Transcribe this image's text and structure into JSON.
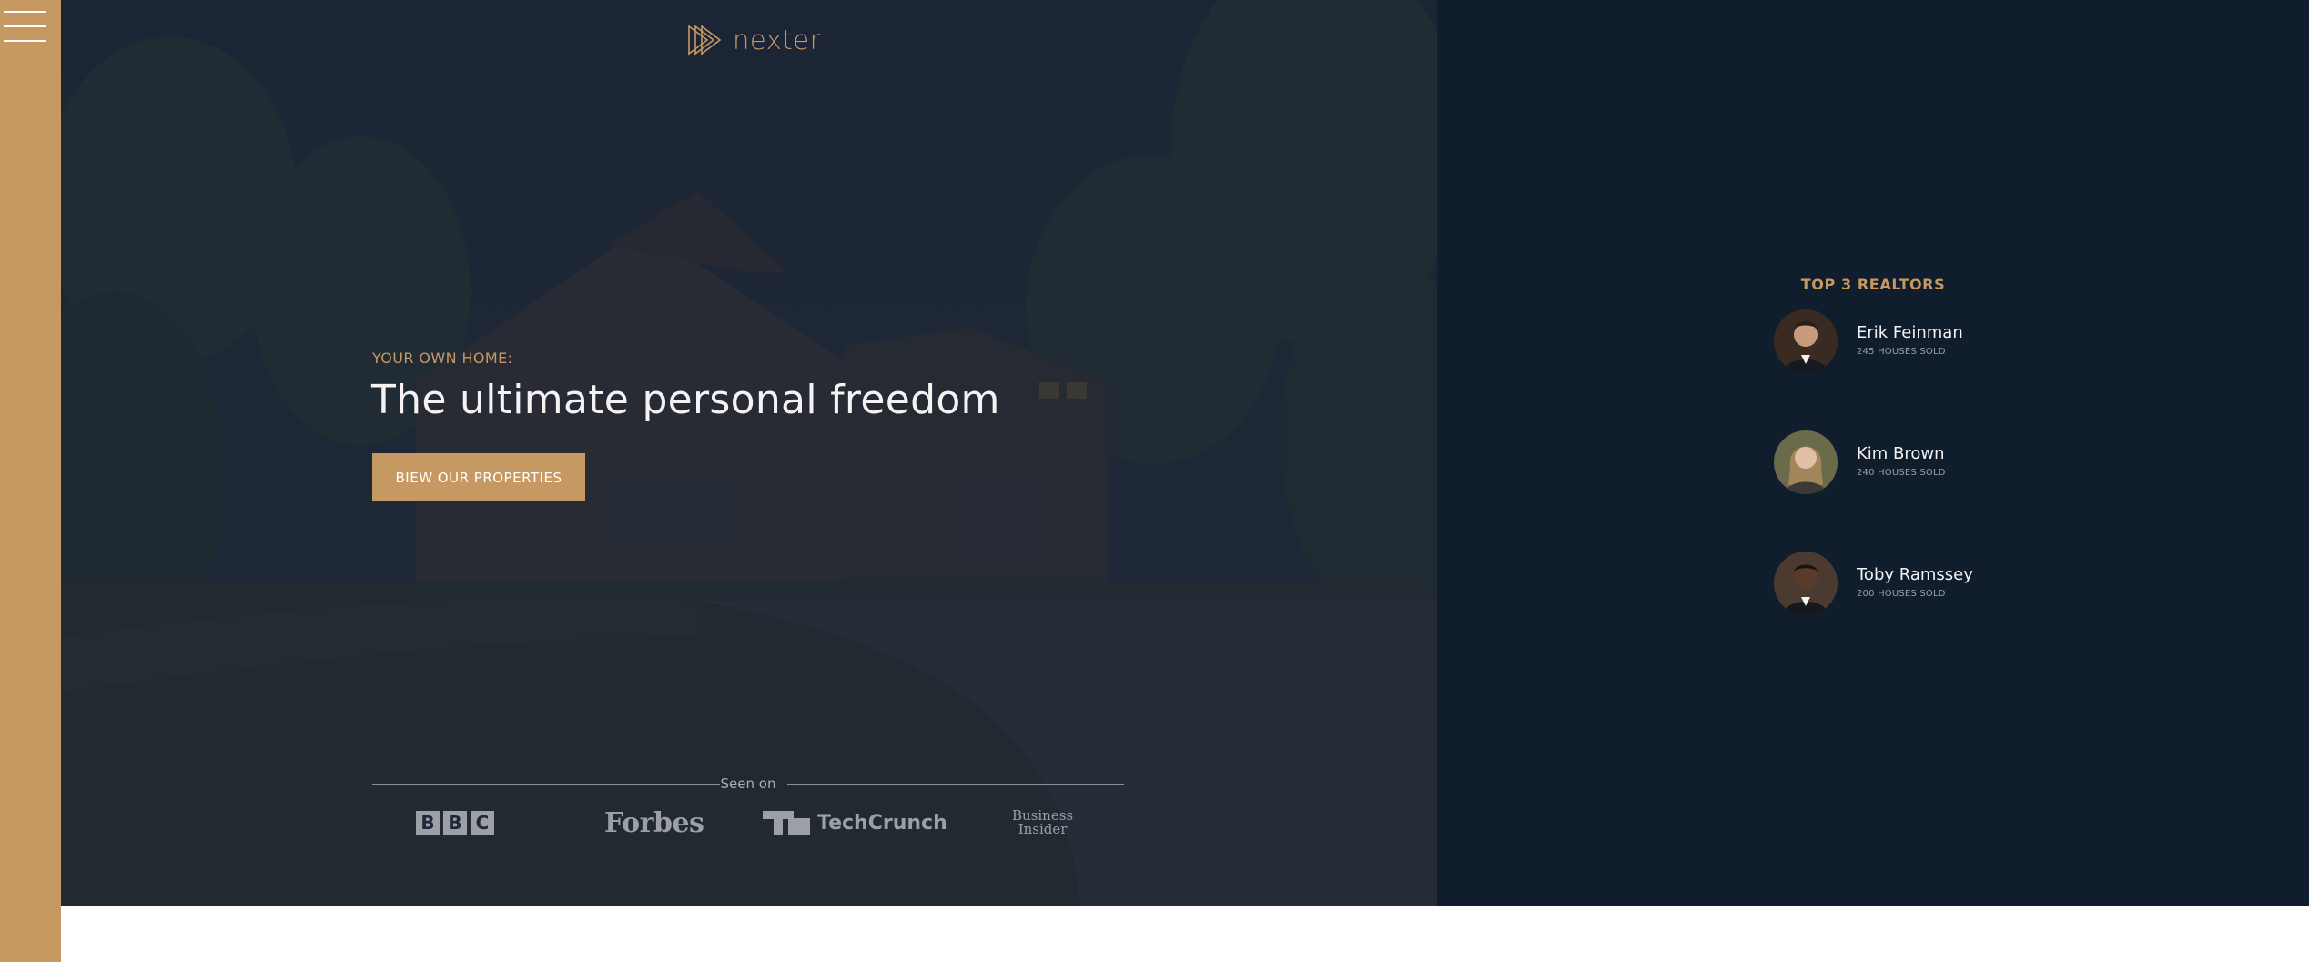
{
  "colors": {
    "primary": "#c69963",
    "dark_panel": "#101d2c",
    "hero_overlay": "#1d2736",
    "text_light": "#f4f2f2"
  },
  "sidebar": {
    "menu_icon": "hamburger-menu-icon"
  },
  "header": {
    "logo_icon": "play-triangles-icon",
    "logo_text": "nexter"
  },
  "hero": {
    "subtitle": "YOUR OWN HOME:",
    "title": "The ultimate personal freedom",
    "cta_label": "BIEW OUR PROPERTIES",
    "background_icon": "house-photo"
  },
  "seen_on": {
    "label": "Seen on",
    "logos": [
      {
        "icon": "bbc-logo",
        "letters": [
          "B",
          "B",
          "C"
        ]
      },
      {
        "icon": "forbes-logo",
        "text": "Forbes"
      },
      {
        "icon": "techcrunch-logo",
        "mark": "TC",
        "text": "TechCrunch"
      },
      {
        "icon": "business-insider-logo",
        "line1": "Business",
        "line2": "Insider"
      }
    ]
  },
  "realtors": {
    "title": "TOP 3 REALTORS",
    "items": [
      {
        "name": "Erik Feinman",
        "sold": "245 HOUSES SOLD",
        "avatar_icon": "realtor-photo-erik"
      },
      {
        "name": "Kim Brown",
        "sold": "240 HOUSES SOLD",
        "avatar_icon": "realtor-photo-kim"
      },
      {
        "name": "Toby Ramssey",
        "sold": "200 HOUSES SOLD",
        "avatar_icon": "realtor-photo-toby"
      }
    ]
  }
}
